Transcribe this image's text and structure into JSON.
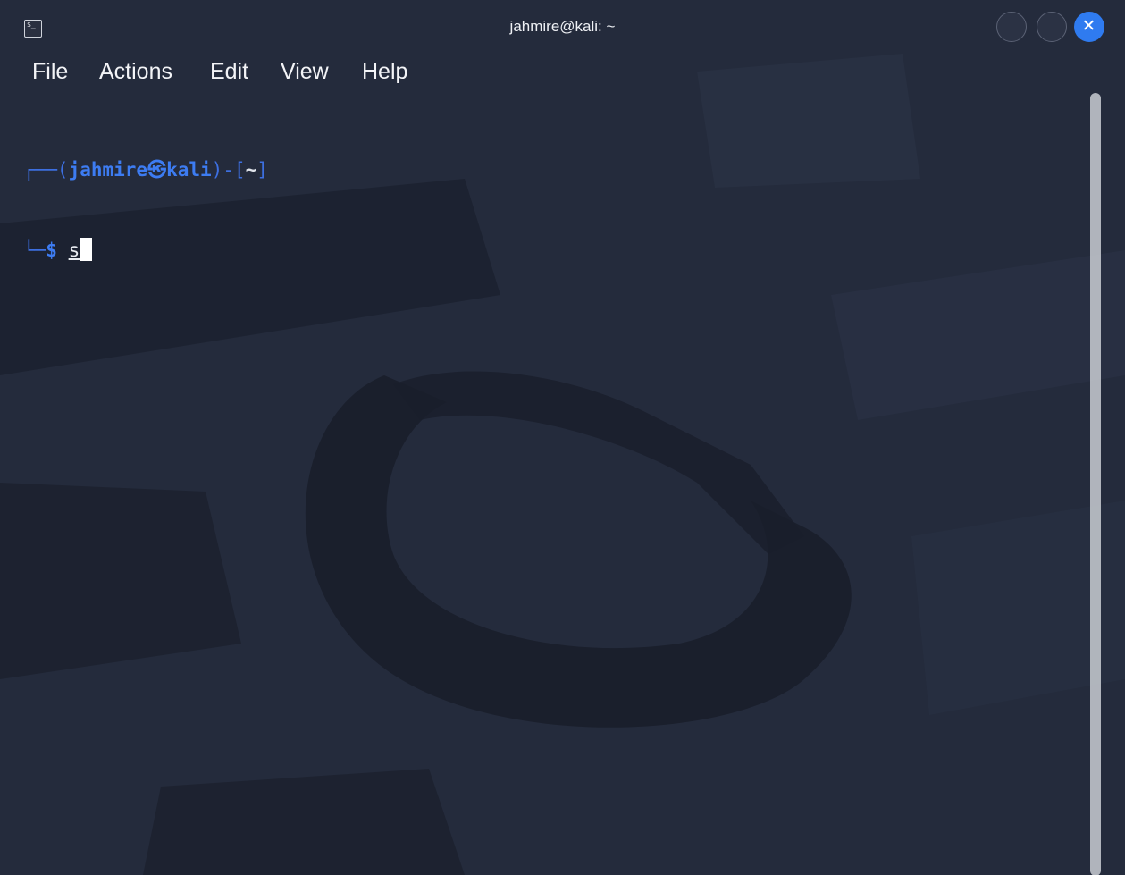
{
  "window": {
    "title": "jahmire@kali: ~",
    "icon": "terminal-icon",
    "icon_glyph": "$_",
    "controls": {
      "minimize_icon": "circle-minimize-icon",
      "maximize_icon": "circle-maximize-icon",
      "close_icon": "close-icon",
      "close_glyph": "✕",
      "accent_color": "#2f7bf0"
    }
  },
  "menu": {
    "items": [
      "File",
      "Actions",
      "Edit",
      "View",
      "Help"
    ]
  },
  "terminal": {
    "prompt": {
      "frame_top": "┌──(",
      "user": "jahmire",
      "separator": "㉿",
      "host": "kali",
      "frame_mid": ")-[",
      "path": "~",
      "frame_end": "]",
      "frame_bottom": "└─",
      "symbol": "$"
    },
    "input": "s",
    "prompt_color": "#3d7cf2"
  },
  "scrollbar": {
    "visible": true
  }
}
